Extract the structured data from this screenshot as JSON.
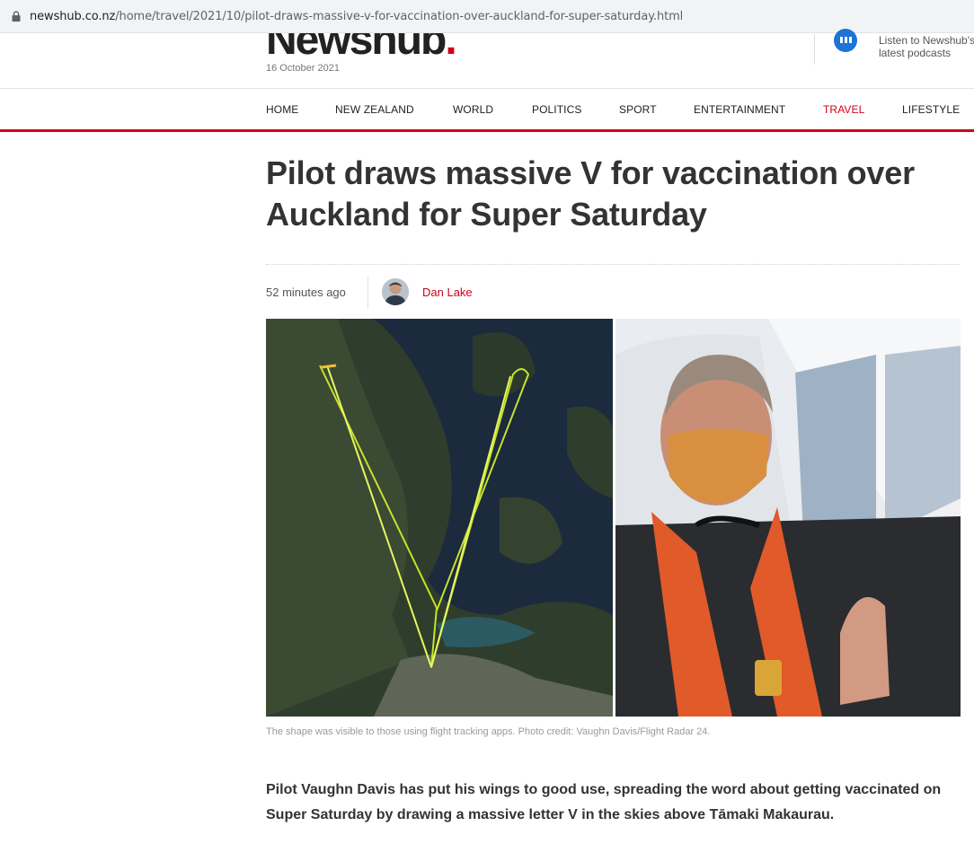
{
  "browser": {
    "url_host": "newshub.co.nz",
    "url_path": "/home/travel/2021/10/pilot-draws-massive-v-for-vaccination-over-auckland-for-super-saturday.html"
  },
  "header": {
    "logo": "Newshub",
    "logo_dot": ".",
    "date": "16 October 2021",
    "podcast_line1": "Listen to Newshub's",
    "podcast_line2": "latest podcasts"
  },
  "nav": {
    "items": [
      {
        "label": "HOME"
      },
      {
        "label": "NEW ZEALAND"
      },
      {
        "label": "WORLD"
      },
      {
        "label": "POLITICS"
      },
      {
        "label": "SPORT"
      },
      {
        "label": "ENTERTAINMENT"
      },
      {
        "label": "TRAVEL",
        "active": true
      },
      {
        "label": "LIFESTYLE"
      }
    ]
  },
  "article": {
    "headline": "Pilot draws massive V for vaccination over Auckland for Super Saturday",
    "time": "52 minutes ago",
    "author": "Dan Lake",
    "caption": "The shape was visible to those using flight tracking apps. Photo credit: Vaughn Davis/Flight Radar 24.",
    "lead": "Pilot Vaughn Davis has put his wings to good use, spreading the word about getting vaccinated on Super Saturday by drawing a massive letter V in the skies above Tāmaki Makaurau."
  },
  "colors": {
    "accent": "#d0021b",
    "podcast_blue": "#1e73d6",
    "flight_path": "#d7ef3a"
  }
}
